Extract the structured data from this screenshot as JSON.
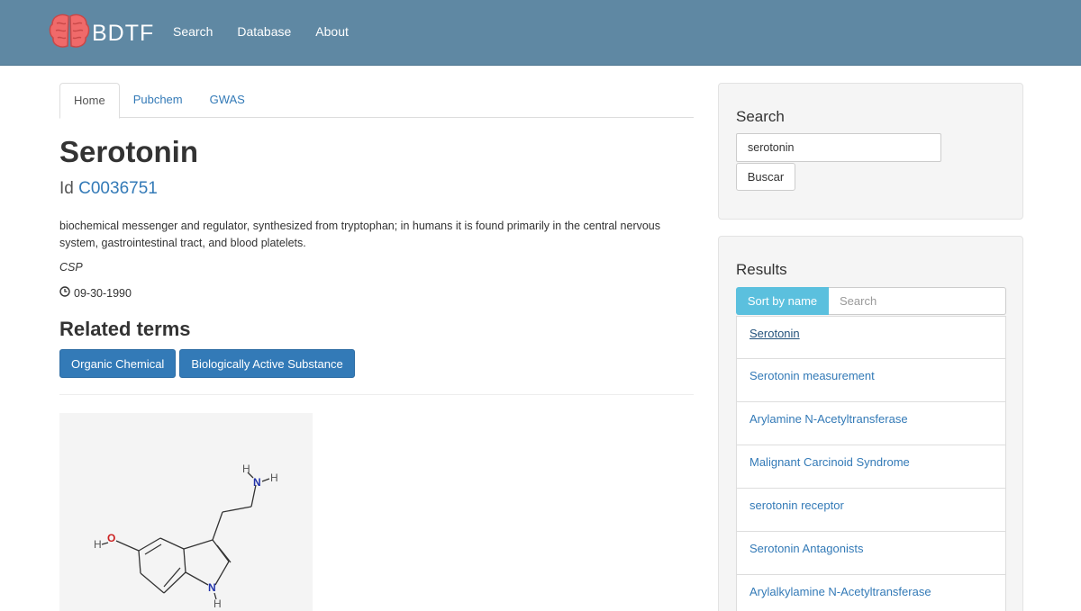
{
  "navbar": {
    "brand": "BDTF",
    "links": [
      "Search",
      "Database",
      "About"
    ]
  },
  "tabs": [
    "Home",
    "Pubchem",
    "GWAS"
  ],
  "compound": {
    "name": "Serotonin",
    "id_label": "Id",
    "id_value": "C0036751",
    "description": "biochemical messenger and regulator, synthesized from tryptophan; in humans it is found primarily in the central nervous system, gastrointestinal tract, and blood platelets.",
    "source": "CSP",
    "date": "09-30-1990"
  },
  "related": {
    "title": "Related terms",
    "terms": [
      "Organic Chemical",
      "Biologically Active Substance"
    ]
  },
  "structure": {
    "atoms": [
      "H",
      "N",
      "H",
      "H",
      "O",
      "N",
      "H"
    ]
  },
  "search_panel": {
    "title": "Search",
    "input_value": "serotonin",
    "button": "Buscar"
  },
  "results_panel": {
    "title": "Results",
    "sort_button": "Sort by name",
    "search_placeholder": "Search",
    "items": [
      "Serotonin",
      "Serotonin measurement",
      "Arylamine N-Acetyltransferase",
      "Malignant Carcinoid Syndrome",
      "serotonin receptor",
      "Serotonin Antagonists",
      "Arylalkylamine N-Acetyltransferase"
    ]
  },
  "colors": {
    "navbar": "#5f88a3",
    "link": "#337ab7",
    "badge": "#337ab7",
    "sort_button": "#5bc0de",
    "brain_logo": "#f06a6a"
  }
}
